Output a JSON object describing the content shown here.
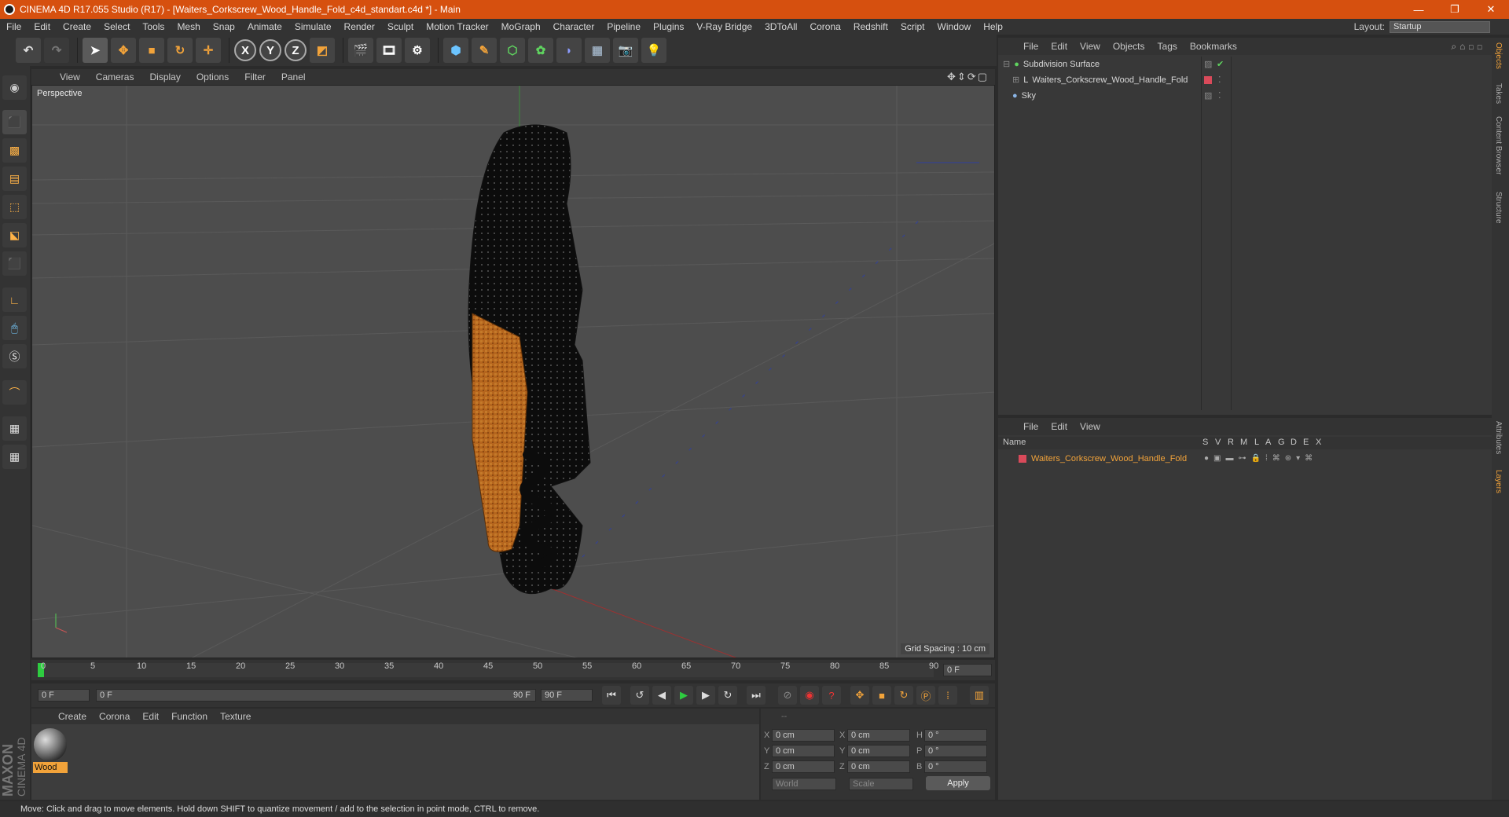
{
  "window": {
    "title": "CINEMA 4D R17.055 Studio (R17) - [Waiters_Corkscrew_Wood_Handle_Fold_c4d_standart.c4d *] - Main",
    "minimize": "—",
    "restore": "❐",
    "close": "✕"
  },
  "menu": [
    "File",
    "Edit",
    "Create",
    "Select",
    "Tools",
    "Mesh",
    "Snap",
    "Animate",
    "Simulate",
    "Render",
    "Sculpt",
    "Motion Tracker",
    "MoGraph",
    "Character",
    "Pipeline",
    "Plugins",
    "V-Ray Bridge",
    "3DToAll",
    "Corona",
    "Redshift",
    "Script",
    "Window",
    "Help"
  ],
  "layout": {
    "label": "Layout:",
    "value": "Startup"
  },
  "toolbar": {
    "x": "X",
    "y": "Y",
    "z": "Z"
  },
  "viewport": {
    "menu": [
      "View",
      "Cameras",
      "Display",
      "Options",
      "Filter",
      "Panel"
    ],
    "label": "Perspective",
    "grid_spacing": "Grid Spacing : 10 cm"
  },
  "timeline": {
    "ticks": [
      "0",
      "5",
      "10",
      "15",
      "20",
      "25",
      "30",
      "35",
      "40",
      "45",
      "50",
      "55",
      "60",
      "65",
      "70",
      "75",
      "80",
      "85",
      "90"
    ],
    "current": "0 F",
    "start": "0 F",
    "range_start": "0 F",
    "range_end": "90 F",
    "end": "90 F"
  },
  "material_menu": [
    "Create",
    "Corona",
    "Edit",
    "Function",
    "Texture"
  ],
  "material": {
    "name": "Wood"
  },
  "coords": {
    "rows": [
      {
        "a": "X",
        "av": "0 cm",
        "b": "X",
        "bv": "0 cm",
        "c": "H",
        "cv": "0 °"
      },
      {
        "a": "Y",
        "av": "0 cm",
        "b": "Y",
        "bv": "0 cm",
        "c": "P",
        "cv": "0 °"
      },
      {
        "a": "Z",
        "av": "0 cm",
        "b": "Z",
        "bv": "0 cm",
        "c": "B",
        "cv": "0 °"
      }
    ],
    "space": "World",
    "mode": "Scale",
    "apply": "Apply"
  },
  "object_manager": {
    "menu": [
      "File",
      "Edit",
      "View",
      "Objects",
      "Tags",
      "Bookmarks"
    ],
    "objects": [
      "Subdivision Surface",
      "Waiters_Corkscrew_Wood_Handle_Fold",
      "Sky"
    ]
  },
  "layer_manager": {
    "menu": [
      "File",
      "Edit",
      "View"
    ],
    "columns": [
      "Name",
      "S",
      "V",
      "R",
      "M",
      "L",
      "A",
      "G",
      "D",
      "E",
      "X"
    ],
    "layer": "Waiters_Corkscrew_Wood_Handle_Fold"
  },
  "right_tabs": [
    "Objects",
    "Takes",
    "Content Browser",
    "Structure",
    "Attributes",
    "Layers"
  ],
  "brand": {
    "maxon": "MAXON",
    "cinema": "CINEMA 4D"
  },
  "status": "Move: Click and drag to move elements. Hold down SHIFT to quantize movement / add to the selection in point mode, CTRL to remove.",
  "colors": {
    "accent": "#d6500f",
    "wood": "#b5651d",
    "select": "#f2a33a"
  }
}
